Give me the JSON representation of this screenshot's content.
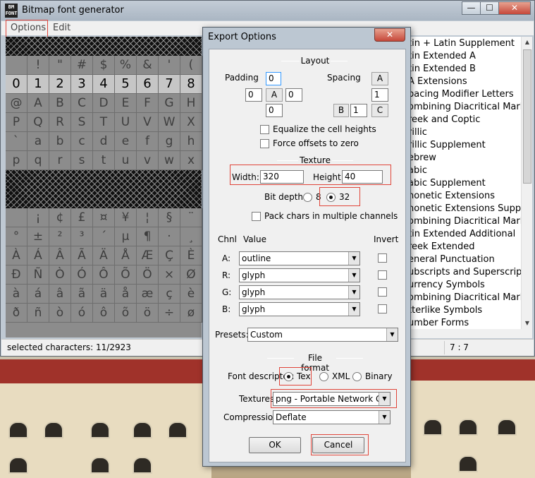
{
  "app": {
    "title": "Bitmap font generator",
    "icon_text": "BM FONT",
    "caption_buttons": [
      "—",
      "☐",
      "✕"
    ]
  },
  "menu": {
    "items": [
      "Options",
      "Edit"
    ]
  },
  "grid": {
    "rows": [
      {
        "kind": "hatch"
      },
      {
        "kind": "chars",
        "chars": [
          " ",
          "!",
          "\"",
          "#",
          "$",
          "%",
          "&",
          "'",
          "("
        ],
        "selected": false
      },
      {
        "kind": "chars",
        "chars": [
          "0",
          "1",
          "2",
          "3",
          "4",
          "5",
          "6",
          "7",
          "8"
        ],
        "selected": true
      },
      {
        "kind": "chars",
        "chars": [
          "@",
          "A",
          "B",
          "C",
          "D",
          "E",
          "F",
          "G",
          "H"
        ],
        "selected": false
      },
      {
        "kind": "chars",
        "chars": [
          "P",
          "Q",
          "R",
          "S",
          "T",
          "U",
          "V",
          "W",
          "X"
        ],
        "selected": false
      },
      {
        "kind": "chars",
        "chars": [
          "`",
          "a",
          "b",
          "c",
          "d",
          "e",
          "f",
          "g",
          "h"
        ],
        "selected": false
      },
      {
        "kind": "chars",
        "chars": [
          "p",
          "q",
          "r",
          "s",
          "t",
          "u",
          "v",
          "w",
          "x"
        ],
        "selected": false
      },
      {
        "kind": "hatch"
      },
      {
        "kind": "chars",
        "chars": [
          "",
          "¡",
          "¢",
          "£",
          "¤",
          "¥",
          "¦",
          "§",
          "¨"
        ],
        "selected": false,
        "hatched_first": true
      },
      {
        "kind": "chars",
        "chars": [
          "°",
          "±",
          "²",
          "³",
          "´",
          "µ",
          "¶",
          "·",
          "¸"
        ],
        "selected": false
      },
      {
        "kind": "chars",
        "chars": [
          "À",
          "Á",
          "Â",
          "Ã",
          "Ä",
          "Å",
          "Æ",
          "Ç",
          "È"
        ],
        "selected": false
      },
      {
        "kind": "chars",
        "chars": [
          "Ð",
          "Ñ",
          "Ò",
          "Ó",
          "Ô",
          "Õ",
          "Ö",
          "×",
          "Ø"
        ],
        "selected": false
      },
      {
        "kind": "chars",
        "chars": [
          "à",
          "á",
          "â",
          "ã",
          "ä",
          "å",
          "æ",
          "ç",
          "è"
        ],
        "selected": false
      },
      {
        "kind": "chars",
        "chars": [
          "ð",
          "ñ",
          "ò",
          "ó",
          "ô",
          "õ",
          "ö",
          "÷",
          "ø"
        ],
        "selected": false
      }
    ]
  },
  "unicode_list": {
    "items": [
      "tin + Latin Supplement",
      "tin Extended A",
      "tin Extended B",
      "A Extensions",
      "pacing Modifier Letters",
      "ombining Diacritical Marks",
      "reek and Coptic",
      "rillic",
      "rillic Supplement",
      "ebrew",
      "abic",
      "abic Supplement",
      "honetic Extensions",
      "honetic Extensions Supple.",
      "ombining Diacritical Marks",
      "tin Extended Additional",
      "reek Extended",
      "eneral Punctuation",
      "ubscripts and Superscripts",
      "urrency Symbols",
      "ombining Diacritical Marks",
      "tterlike Symbols",
      "umber Forms"
    ]
  },
  "status": {
    "left": "selected characters: 11/2923",
    "right": "7 : 7"
  },
  "dialog": {
    "title": "Export Options",
    "close": "✕",
    "layout": {
      "heading": "Layout",
      "padding_label": "Padding",
      "padding": {
        "up": "0",
        "left": "0",
        "center": "A",
        "right": "0",
        "down": "0"
      },
      "spacing_label": "Spacing",
      "spacing": {
        "top_letter": "A",
        "vertical": "1",
        "horizontal": "1",
        "left_letter": "B",
        "right_letter": "C"
      },
      "equalize_label": "Equalize the cell heights",
      "force_offsets_label": "Force offsets to zero"
    },
    "texture": {
      "heading": "Texture",
      "width_label": "Width:",
      "width": "320",
      "height_label": "Height:",
      "height": "40",
      "bitdepth_label": "Bit depth:",
      "bitdepth_options": [
        "8",
        "32"
      ],
      "bitdepth_selected": "32",
      "pack_label": "Pack chars in multiple channels"
    },
    "channels": {
      "col_chnl": "Chnl",
      "col_value": "Value",
      "col_invert": "Invert",
      "rows": [
        {
          "chnl": "A:",
          "value": "outline"
        },
        {
          "chnl": "R:",
          "value": "glyph"
        },
        {
          "chnl": "G:",
          "value": "glyph"
        },
        {
          "chnl": "B:",
          "value": "glyph"
        }
      ]
    },
    "presets_label": "Presets:",
    "presets_value": "Custom",
    "file_format": {
      "heading": "File format",
      "descriptor_label": "Font descriptor:",
      "descriptor_options": [
        "Text",
        "XML",
        "Binary"
      ],
      "descriptor_selected": "Text",
      "textures_label": "Textures:",
      "textures_value": "png - Portable Network Graphic",
      "compression_label": "Compression:",
      "compression_value": "Deflate"
    },
    "ok_label": "OK",
    "cancel_label": "Cancel"
  },
  "colors": {
    "highlight_box": "#e0453a",
    "selection_marker": "#5bd0e8",
    "titlebar": "#bfc9d3"
  }
}
